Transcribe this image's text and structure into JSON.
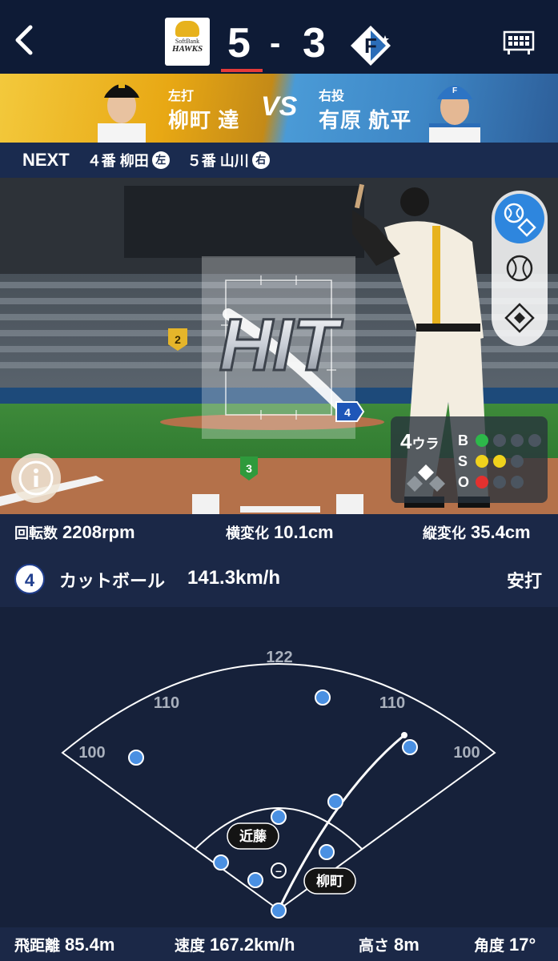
{
  "header": {
    "back_icon": "chevron-left-icon",
    "home_team": {
      "logo_line1": "SoftBank",
      "logo_line2": "HAWKS",
      "score": "5"
    },
    "score_separator": "-",
    "away_team": {
      "logo_letter": "F",
      "score": "3"
    },
    "board_icon": "scoreboard-icon"
  },
  "matchup": {
    "batter": {
      "role": "左打",
      "name": "柳町 達"
    },
    "vs": "VS",
    "pitcher": {
      "role": "右投",
      "name": "有原 航平"
    }
  },
  "next": {
    "label": "NEXT",
    "batters": [
      {
        "order": "４番 柳田",
        "hand": "左"
      },
      {
        "order": "５番 山川",
        "hand": "右"
      }
    ]
  },
  "pitch_view": {
    "banner": "HIT",
    "pitch_markers": [
      "2",
      "3",
      "4"
    ],
    "view_controls": [
      "pitch-view-icon",
      "ball-icon",
      "diamond-icon"
    ],
    "info_icon": "info-icon",
    "count": {
      "inning": "4",
      "half": "ウラ",
      "balls_label": "B",
      "balls": 1,
      "strikes_label": "S",
      "strikes": 2,
      "outs_label": "O",
      "outs": 1
    },
    "colors": {
      "ball": "#2db84a",
      "strike": "#f0d21c",
      "out": "#e3312f",
      "off": "#4b5560"
    }
  },
  "pitch_stats": {
    "spin_label": "回転数",
    "spin_value": "2208rpm",
    "hbreak_label": "横変化",
    "hbreak_value": "10.1cm",
    "vbreak_label": "縦変化",
    "vbreak_value": "35.4cm",
    "pitch_number": "4",
    "pitch_type": "カットボール",
    "speed": "141.3km/h",
    "result": "安打"
  },
  "spray_chart": {
    "fence_labels": [
      "100",
      "110",
      "122",
      "110",
      "100"
    ],
    "fielder_tags": [
      "近藤",
      "柳町"
    ],
    "runner_marker": "–"
  },
  "hit_stats": {
    "distance_label": "飛距離",
    "distance_value": "85.4m",
    "exit_speed_label": "速度",
    "exit_speed_value": "167.2km/h",
    "height_label": "高さ",
    "height_value": "8m",
    "angle_label": "角度",
    "angle_value": "17°"
  }
}
